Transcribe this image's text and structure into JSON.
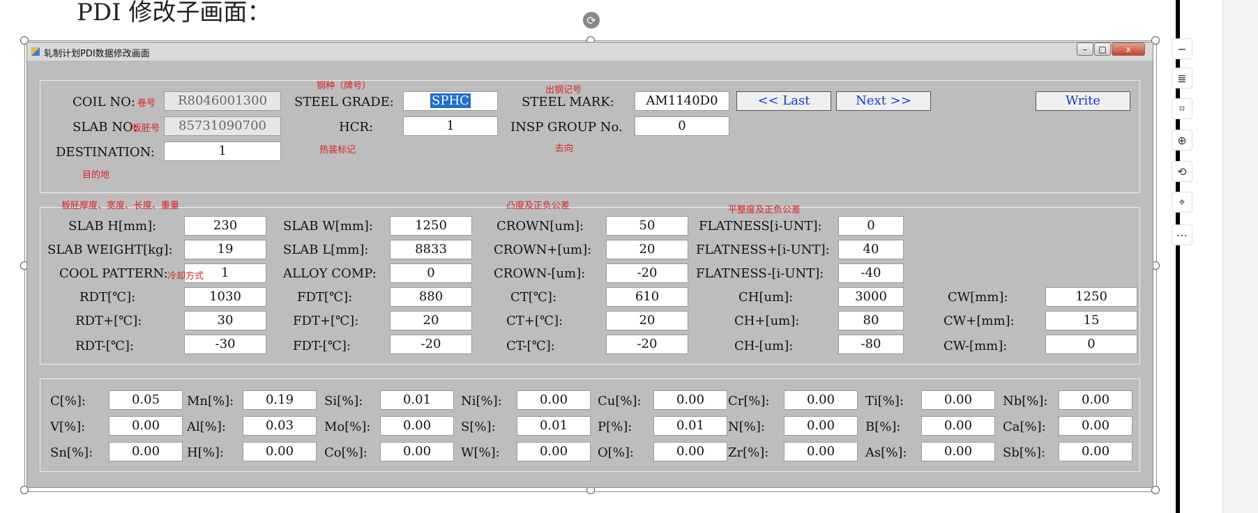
{
  "doc_heading": "PDI 修改子画面：",
  "window": {
    "title": "轧制计划PDI数据修改画面",
    "min": "–",
    "max": "□",
    "close": "x"
  },
  "header_fields": {
    "coil_no": {
      "label": "COIL NO:",
      "value": "R8046001300",
      "note": "卷号"
    },
    "slab_no": {
      "label": "SLAB NO:",
      "value": "85731090700",
      "note": "板胚号"
    },
    "destination": {
      "label": "DESTINATION:",
      "value": "1",
      "note": "目的地"
    },
    "steel_grade": {
      "label": "STEEL GRADE:",
      "value": "SPHC",
      "note": "钢种（牌号）"
    },
    "hcr": {
      "label": "HCR:",
      "value": "1",
      "note": "热装标记"
    },
    "steel_mark": {
      "label": "STEEL MARK:",
      "value": "AM1140D0",
      "note": "出钢记号"
    },
    "insp_group": {
      "label": "INSP GROUP No.",
      "value": "0",
      "note": "去向"
    }
  },
  "buttons": {
    "last": "<< Last",
    "next": "Next >>",
    "write": "Write"
  },
  "slab_notes": {
    "dims": "板胚厚度、宽度、长度、重量",
    "crown": "凸度及正负公差",
    "flatness": "平整度及正负公差",
    "cool": "冷却方式"
  },
  "slab": {
    "slab_h": {
      "label": "SLAB H[mm]:",
      "value": "230"
    },
    "slab_weight": {
      "label": "SLAB WEIGHT[kg]:",
      "value": "19"
    },
    "cool_pattern": {
      "label": "COOL PATTERN:",
      "value": "1"
    },
    "rdt": {
      "label": "RDT[℃]:",
      "value": "1030"
    },
    "rdt_plus": {
      "label": "RDT+[℃]:",
      "value": "30"
    },
    "rdt_minus": {
      "label": "RDT-[℃]:",
      "value": "-30"
    },
    "slab_w": {
      "label": "SLAB W[mm]:",
      "value": "1250"
    },
    "slab_l": {
      "label": "SLAB L[mm]:",
      "value": "8833"
    },
    "alloy_comp": {
      "label": "ALLOY COMP:",
      "value": "0"
    },
    "fdt": {
      "label": "FDT[℃]:",
      "value": "880"
    },
    "fdt_plus": {
      "label": "FDT+[℃]:",
      "value": "20"
    },
    "fdt_minus": {
      "label": "FDT-[℃]:",
      "value": "-20"
    },
    "crown": {
      "label": "CROWN[um]:",
      "value": "50"
    },
    "crown_plus": {
      "label": "CROWN+[um]:",
      "value": "20"
    },
    "crown_minus": {
      "label": "CROWN-[um]:",
      "value": "-20"
    },
    "ct": {
      "label": "CT[℃]:",
      "value": "610"
    },
    "ct_plus": {
      "label": "CT+[℃]:",
      "value": "20"
    },
    "ct_minus": {
      "label": "CT-[℃]:",
      "value": "-20"
    },
    "flatness": {
      "label": "FLATNESS[i-UNT]:",
      "value": "0"
    },
    "flatness_plus": {
      "label": "FLATNESS+[i-UNT]:",
      "value": "40"
    },
    "flatness_minus": {
      "label": "FLATNESS-[i-UNT]:",
      "value": "-40"
    },
    "ch": {
      "label": "CH[um]:",
      "value": "3000"
    },
    "ch_plus": {
      "label": "CH+[um]:",
      "value": "80"
    },
    "ch_minus": {
      "label": "CH-[um]:",
      "value": "-80"
    },
    "cw": {
      "label": "CW[mm]:",
      "value": "1250"
    },
    "cw_plus": {
      "label": "CW+[mm]:",
      "value": "15"
    },
    "cw_minus": {
      "label": "CW-[mm]:",
      "value": "0"
    }
  },
  "chem": [
    {
      "label": "C[%]:",
      "value": "0.05"
    },
    {
      "label": "Mn[%]:",
      "value": "0.19"
    },
    {
      "label": "Si[%]:",
      "value": "0.01"
    },
    {
      "label": "Ni[%]:",
      "value": "0.00"
    },
    {
      "label": "Cu[%]:",
      "value": "0.00"
    },
    {
      "label": "Cr[%]:",
      "value": "0.00"
    },
    {
      "label": "Ti[%]:",
      "value": "0.00"
    },
    {
      "label": "Nb[%]:",
      "value": "0.00"
    },
    {
      "label": "V[%]:",
      "value": "0.00"
    },
    {
      "label": "Al[%]:",
      "value": "0.03"
    },
    {
      "label": "Mo[%]:",
      "value": "0.00"
    },
    {
      "label": "S[%]:",
      "value": "0.01"
    },
    {
      "label": "P[%]:",
      "value": "0.01"
    },
    {
      "label": "N[%]:",
      "value": "0.00"
    },
    {
      "label": "B[%]:",
      "value": "0.00"
    },
    {
      "label": "Ca[%]:",
      "value": "0.00"
    },
    {
      "label": "Sn[%]:",
      "value": "0.00"
    },
    {
      "label": "H[%]:",
      "value": "0.00"
    },
    {
      "label": "Co[%]:",
      "value": "0.00"
    },
    {
      "label": "W[%]:",
      "value": "0.00"
    },
    {
      "label": "O[%]:",
      "value": "0.00"
    },
    {
      "label": "Zr[%]:",
      "value": "0.00"
    },
    {
      "label": "As[%]:",
      "value": "0.00"
    },
    {
      "label": "Sb[%]:",
      "value": "0.00"
    }
  ],
  "tools": [
    "minus-icon",
    "text-wrap-icon",
    "crop-icon",
    "zoom-in-icon",
    "rotate-icon",
    "scan-icon",
    "more-icon"
  ],
  "tool_glyphs": [
    "−",
    "≣",
    "⌗",
    "⊕",
    "⟲",
    "⌖",
    "⋯"
  ],
  "colors": {
    "note": "#e02020",
    "button_text": "#1238d6",
    "selection": "#1f6fd1",
    "window_bg": "#bdbdbd"
  }
}
